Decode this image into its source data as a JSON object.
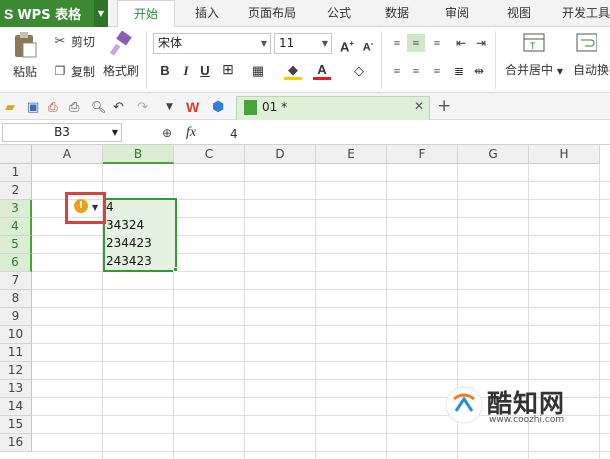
{
  "app": {
    "logo": "S",
    "name": "WPS 表格"
  },
  "tabs": [
    "开始",
    "插入",
    "页面布局",
    "公式",
    "数据",
    "审阅",
    "视图",
    "开发工具"
  ],
  "active_tab": "开始",
  "ribbon": {
    "paste": "粘贴",
    "cut": "剪切",
    "copy": "复制",
    "format_painter": "格式刷",
    "font_name": "宋体",
    "font_size": "11",
    "merge_center": "合并居中",
    "wrap": "自动换行"
  },
  "document_tab": {
    "name": "01 *"
  },
  "formula_bar": {
    "cell_ref": "B3",
    "fx": "fx",
    "value": "4"
  },
  "columns": [
    "A",
    "B",
    "C",
    "D",
    "E",
    "F",
    "G",
    "H"
  ],
  "selected_column": "B",
  "rows": [
    "1",
    "2",
    "3",
    "4",
    "5",
    "6",
    "7",
    "8",
    "9",
    "10",
    "11",
    "12",
    "13",
    "14",
    "15",
    "16"
  ],
  "selected_rows": [
    "3",
    "4",
    "5",
    "6"
  ],
  "cells": {
    "B3": "4",
    "B4": "34324",
    "B5": "234423",
    "B6": "243423"
  },
  "warning_icon": "!",
  "watermark": {
    "text": "酷知网",
    "url": "www.coozhi.com"
  },
  "colors": {
    "accent": "#3a963a",
    "brand": "#3b8a33",
    "warning": "#e8a21a",
    "highlight": "#d94040"
  }
}
